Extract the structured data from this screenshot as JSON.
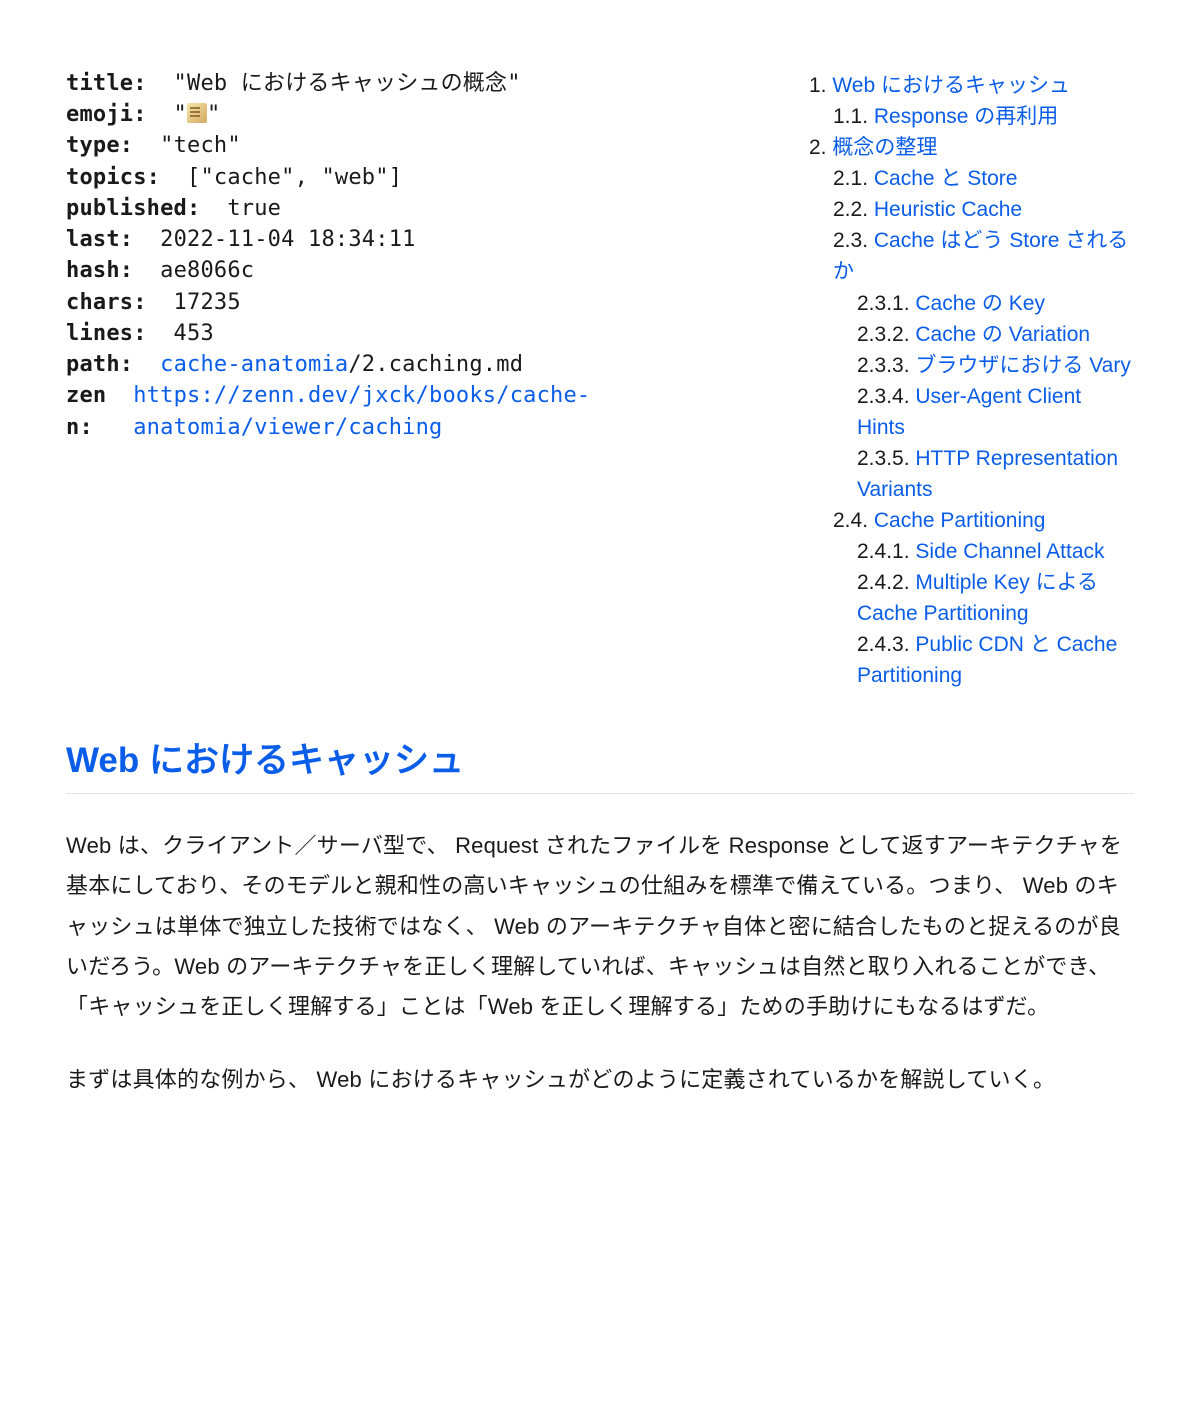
{
  "meta": {
    "title_key": "title:",
    "title_val": "  \"Web におけるキャッシュの概念\"",
    "emoji_key": "emoji:",
    "emoji_pre": "  \"",
    "emoji_name": "memo",
    "emoji_post": "\"",
    "type_key": "type:",
    "type_val": "  \"tech\"",
    "topics_key": "topics:",
    "topics_val": "  [\"cache\", \"web\"]",
    "published_key": "published:",
    "published_val": "  true",
    "last_key": "last:",
    "last_val": "  2022-11-04 18:34:11",
    "hash_key": "hash:",
    "hash_val": "  ae8066c",
    "chars_key": "chars:",
    "chars_val": "  17235",
    "lines_key": "lines:",
    "lines_val": "  453",
    "path_key": "path:",
    "path_sp": "  ",
    "path_link": "cache-anatomia",
    "path_rest": "/2.caching.md",
    "zenn_key1": "zen",
    "zenn_sp1": "  ",
    "zenn_link1": "https://zenn.dev/jxck/books/cache-",
    "zenn_key2": "n:",
    "zenn_sp2": "   ",
    "zenn_link2": "anatomia/viewer/caching"
  },
  "toc": [
    {
      "lvl": 1,
      "num": "1.",
      "label": "Web におけるキャッシュ"
    },
    {
      "lvl": 2,
      "num": "1.1.",
      "label": "Response の再利用"
    },
    {
      "lvl": 1,
      "num": "2.",
      "label": "概念の整理"
    },
    {
      "lvl": 2,
      "num": "2.1.",
      "label": "Cache と Store"
    },
    {
      "lvl": 2,
      "num": "2.2.",
      "label": "Heuristic Cache"
    },
    {
      "lvl": 2,
      "num": "2.3.",
      "label": "Cache はどう Store されるか"
    },
    {
      "lvl": 3,
      "num": "2.3.1.",
      "label": "Cache の Key"
    },
    {
      "lvl": 3,
      "num": "2.3.2.",
      "label": "Cache の Variation"
    },
    {
      "lvl": 3,
      "num": "2.3.3.",
      "label": "ブラウザにおける Vary"
    },
    {
      "lvl": 3,
      "num": "2.3.4.",
      "label": "User-Agent Client Hints"
    },
    {
      "lvl": 3,
      "num": "2.3.5.",
      "label": "HTTP Representation Variants"
    },
    {
      "lvl": 2,
      "num": "2.4.",
      "label": "Cache Partitioning"
    },
    {
      "lvl": 3,
      "num": "2.4.1.",
      "label": "Side Channel Attack"
    },
    {
      "lvl": 3,
      "num": "2.4.2.",
      "label": "Multiple Key による Cache Partitioning"
    },
    {
      "lvl": 3,
      "num": "2.4.3.",
      "label": "Public CDN と Cache Partitioning"
    }
  ],
  "section": {
    "heading": "Web におけるキャッシュ",
    "p1": "Web は、クライアント／サーバ型で、 Request されたファイルを Response として返すアーキテクチャを基本にしており、そのモデルと親和性の高いキャッシュの仕組みを標準で備えている。つまり、 Web のキャッシュは単体で独立した技術ではなく、 Web のアーキテクチャ自体と密に結合したものと捉えるのが良いだろう。Web のアーキテクチャを正しく理解していれば、キャッシュは自然と取り入れることができ、「キャッシュを正しく理解する」ことは「Web を正しく理解する」ための手助けにもなるはずだ。",
    "p2": "まずは具体的な例から、 Web におけるキャッシュがどのように定義されているかを解説していく。"
  }
}
